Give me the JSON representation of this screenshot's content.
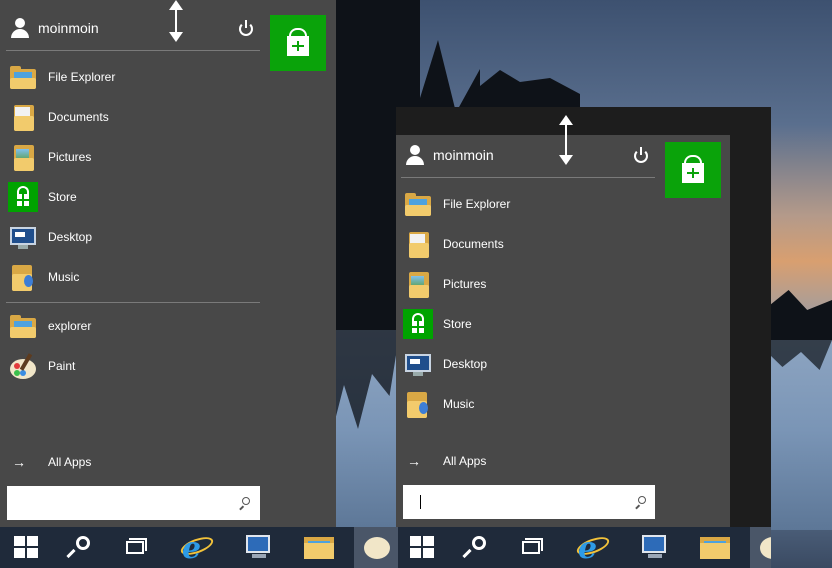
{
  "colors": {
    "menu_bg": "#484848",
    "separator": "#7a7a7a",
    "store_green": "#0aa30a",
    "taskbar_bg": "#1f2a3a",
    "text": "#ffffff"
  },
  "menus": [
    {
      "user": {
        "name": "moinmoin",
        "icon": "user-icon"
      },
      "power_icon": "power-icon",
      "resize_icon": "resize-vertical-arrow-icon",
      "pinned": [
        {
          "label": "File Explorer",
          "icon": "file-explorer-folder-icon"
        },
        {
          "label": "Documents",
          "icon": "documents-folder-icon"
        },
        {
          "label": "Pictures",
          "icon": "pictures-folder-icon"
        },
        {
          "label": "Store",
          "icon": "store-icon"
        },
        {
          "label": "Desktop",
          "icon": "desktop-icon"
        },
        {
          "label": "Music",
          "icon": "music-folder-icon"
        }
      ],
      "recent": [
        {
          "label": "explorer",
          "icon": "explorer-folder-icon"
        },
        {
          "label": "Paint",
          "icon": "paint-icon"
        }
      ],
      "all_apps": {
        "label": "All Apps",
        "icon": "arrow-right-icon"
      },
      "search": {
        "value": "",
        "placeholder": ""
      },
      "tile": {
        "icon": "store-tile-icon"
      }
    },
    {
      "user": {
        "name": "moinmoin",
        "icon": "user-icon"
      },
      "power_icon": "power-icon",
      "resize_icon": "resize-vertical-arrow-icon",
      "pinned": [
        {
          "label": "File Explorer",
          "icon": "file-explorer-folder-icon"
        },
        {
          "label": "Documents",
          "icon": "documents-folder-icon"
        },
        {
          "label": "Pictures",
          "icon": "pictures-folder-icon"
        },
        {
          "label": "Store",
          "icon": "store-icon"
        },
        {
          "label": "Desktop",
          "icon": "desktop-icon"
        },
        {
          "label": "Music",
          "icon": "music-folder-icon"
        }
      ],
      "all_apps": {
        "label": "All Apps",
        "icon": "arrow-right-icon"
      },
      "search": {
        "value": "",
        "placeholder": ""
      },
      "tile": {
        "icon": "store-tile-icon"
      }
    }
  ],
  "taskbar": {
    "items": [
      "start-windows-icon",
      "search-icon",
      "task-view-icon",
      "internet-explorer-icon",
      "remote-desktop-icon",
      "file-explorer-icon",
      "paint-icon"
    ]
  },
  "all_apps_arrow": "→"
}
